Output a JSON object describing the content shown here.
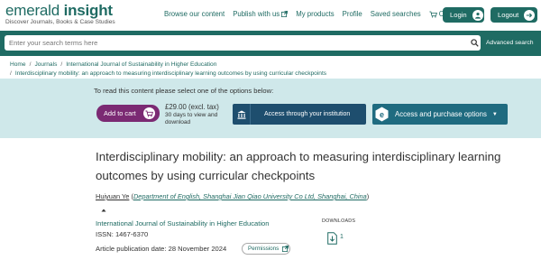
{
  "brand": {
    "name_regular": "emerald",
    "name_bold": "insight",
    "tagline": "Discover Journals, Books & Case Studies"
  },
  "topnav": {
    "items": [
      "Browse our content",
      "Publish with us",
      "My products",
      "Profile",
      "Saved searches",
      "Cart"
    ],
    "login_label": "Login",
    "logout_label": "Logout"
  },
  "search": {
    "placeholder": "Enter your search terms here",
    "advanced_label": "Advanced search"
  },
  "breadcrumb": {
    "items": [
      "Home",
      "Journals",
      "International Journal of Sustainability in Higher Education"
    ],
    "current": "Interdisciplinary mobility: an approach to measuring interdisciplinary learning outcomes by using curricular checkpoints"
  },
  "access": {
    "prompt": "To read this content please select one of the options below:",
    "add_to_cart_label": "Add to cart",
    "price": "£29.00 (excl. tax)",
    "price_note": "30 days to view and download",
    "institution_label": "Access through your institution",
    "purchase_label": "Access and purchase options"
  },
  "article": {
    "title": "Interdisciplinary mobility: an approach to measuring interdisciplinary learning outcomes by using curricular checkpoints",
    "author_name": "Huiyuan Ye",
    "affiliation_1": "Department of English, Shanghai Jian Qiao University Co Ltd, Shanghai, China",
    "journal": "International Journal of Sustainability in Higher Education",
    "issn": "ISSN: 1467-6370",
    "pub_date": "Article publication date: 28 November 2024",
    "permissions_label": "Permissions",
    "downloads_label": "DOWNLOADS",
    "downloads_count": "1"
  },
  "colors": {
    "brand_teal": "#1f6b63",
    "band_bg": "#cfe8ea",
    "cart_purple": "#7b2a73",
    "institution_navy": "#1e4e6e",
    "purchase_blue": "#1f6b80"
  }
}
